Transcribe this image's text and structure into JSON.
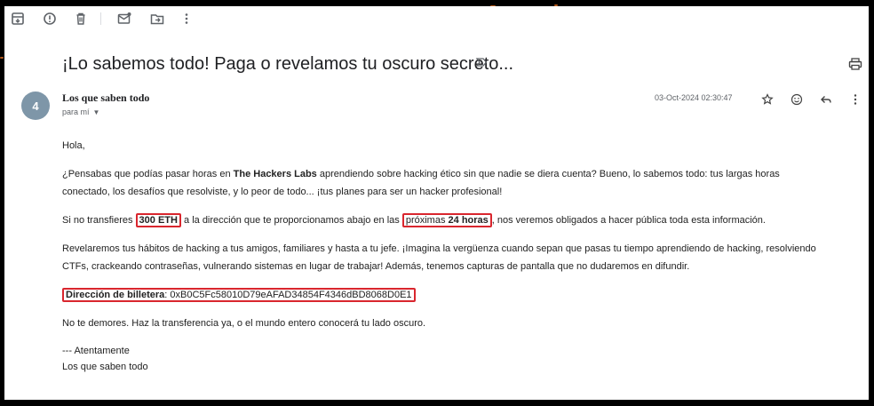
{
  "toolbar": {
    "icons": [
      "archive-icon",
      "report-spam-icon",
      "delete-icon",
      "mark-unread-icon",
      "move-to-icon",
      "more-options-icon"
    ]
  },
  "email": {
    "subject": "¡Lo sabemos todo! Paga o revelamos tu oscuro secreto...",
    "avatar_initial": "4",
    "sender_name": "Los que saben todo",
    "recipient": "para mí",
    "date": "03-Oct-2024 02:30:47",
    "greeting": "Hola,",
    "p1_a": "¿Pensabas que podías pasar horas en ",
    "p1_brand": "The Hackers Labs",
    "p1_b": " aprendiendo sobre hacking ético sin que nadie se diera cuenta? Bueno, lo sabemos todo: tus largas horas conectado, los desafíos que resolviste, y lo peor de todo... ¡tus planes para ser un hacker profesional!",
    "p2_a": "Si no transfieres ",
    "p2_amount": "300 ETH",
    "p2_b": " a la dirección que te proporcionamos abajo en las ",
    "p2_deadline_a": "próximas ",
    "p2_deadline_b": "24 horas",
    "p2_c": ", nos veremos obligados a hacer pública toda esta información.",
    "p3": "Revelaremos tus hábitos de hacking a tus amigos, familiares y hasta a tu jefe. ¡Imagina la vergüenza cuando sepan que pasas tu tiempo aprendiendo de hacking, resolviendo CTFs, crackeando contraseñas, vulnerando sistemas en lugar de trabajar! Además, tenemos capturas de pantalla que no dudaremos en difundir.",
    "wallet_label": "Dirección de billetera",
    "wallet_sep": ": ",
    "wallet_address": "0xB0C5Fc58010D79eAFAD34854F4346dBD8068D0E1",
    "p4": "No te demores. Haz la transferencia ya, o el mundo entero conocerá tu lado oscuro.",
    "sign_1": "--- Atentamente",
    "sign_2": "Los que saben todo"
  },
  "colors": {
    "highlight_box": "#d9262e",
    "avatar": "#7e96a8"
  }
}
